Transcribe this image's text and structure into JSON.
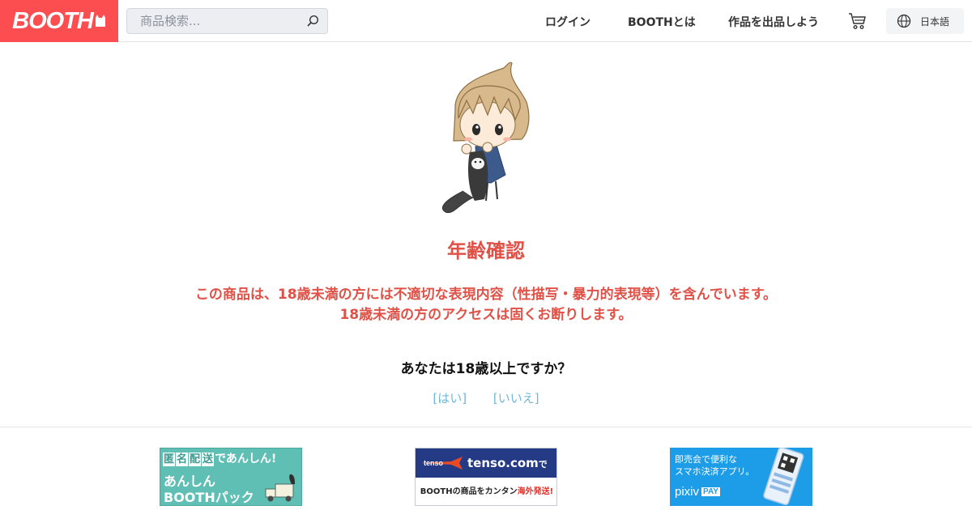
{
  "header": {
    "logo_text": "BOOTH",
    "search": {
      "placeholder": "商品検索...",
      "value": ""
    },
    "nav": [
      {
        "label": "ログイン"
      },
      {
        "label": "BOOTHとは"
      },
      {
        "label": "作品を出品しよう"
      }
    ],
    "language_label": "日本語"
  },
  "main": {
    "title": "年齢確認",
    "warning_line1": "この商品は、18歳未満の方には不適切な表現内容（性描写・暴力的表現等）を含んでいます。",
    "warning_line2": "18歳未満の方のアクセスは固くお断りします。",
    "question": "あなたは18歳以上ですか？",
    "yes_label": "[はい]",
    "no_label": "[いいえ]"
  },
  "banners": {
    "anonymous": {
      "box1": "匿",
      "box2": "名",
      "box3": "配",
      "box4": "送",
      "top_rest": "であんしん!",
      "line1": "あんしん",
      "line2": "BOOTHパック"
    },
    "tenso": {
      "plane_label": "tenso",
      "name": "tenso.com",
      "name_suffix": "で",
      "bottom_black": "BOOTHの商品をカンタン",
      "bottom_red": "海外発送!"
    },
    "pixiv": {
      "line1": "即売会で便利な",
      "line2": "スマホ決済アプリ。",
      "logo": "pixiv",
      "pay": "PAY"
    }
  },
  "colors": {
    "brand": "#fc4d50",
    "alert": "#e05248",
    "link": "#6fb8d8"
  }
}
